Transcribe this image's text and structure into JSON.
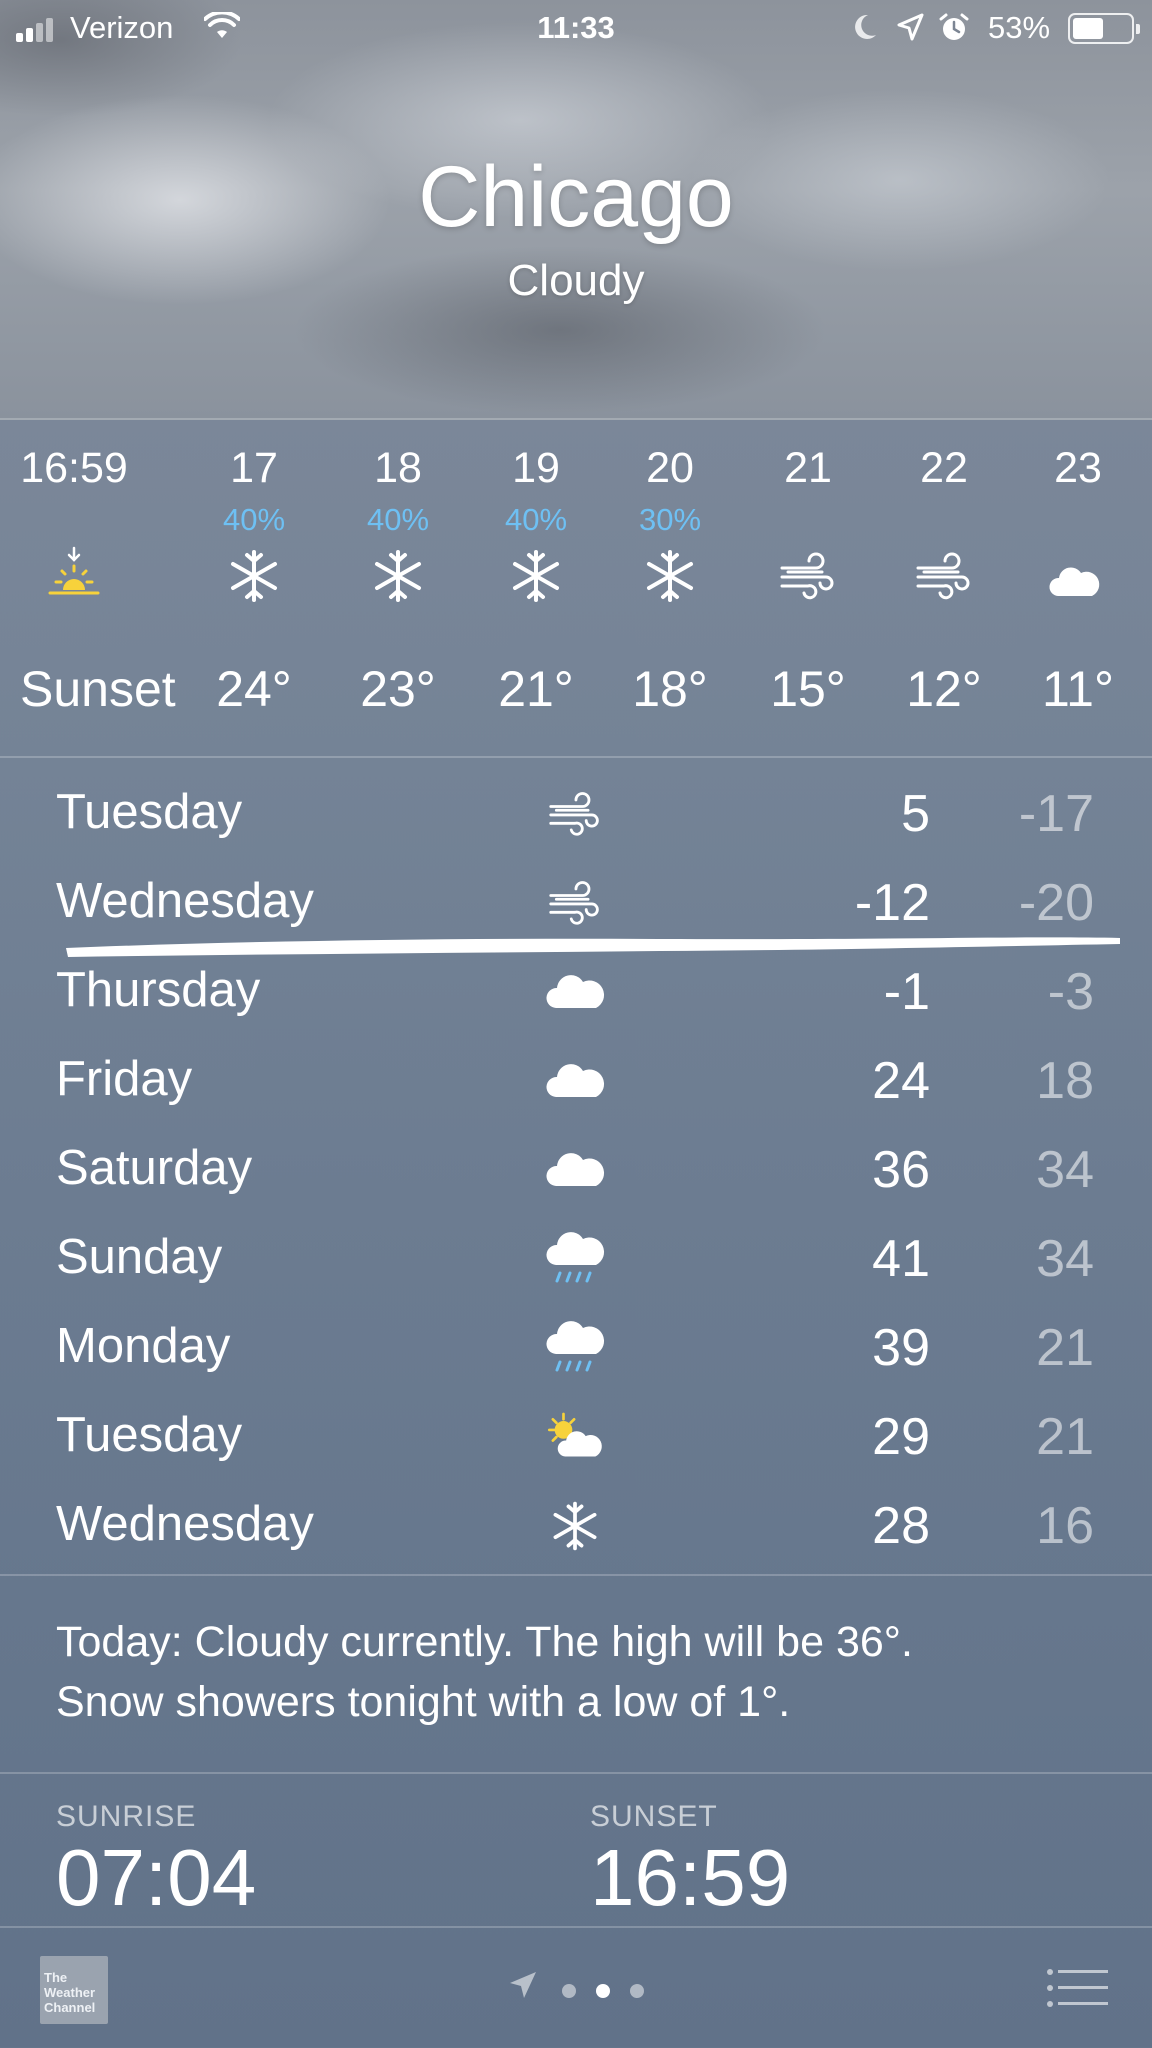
{
  "status_bar": {
    "carrier": "Verizon",
    "time": "11:33",
    "battery_percent": "53%",
    "battery_level": 0.53,
    "icons": [
      "signal-icon",
      "wifi-icon",
      "moon-icon",
      "location-arrow-icon",
      "alarm-icon",
      "battery-icon"
    ]
  },
  "header": {
    "city": "Chicago",
    "condition": "Cloudy"
  },
  "hourly": [
    {
      "time": "16:59",
      "pop": "",
      "icon": "sunset-icon",
      "temp": "Sunset"
    },
    {
      "time": "17",
      "pop": "40%",
      "icon": "snow-icon",
      "temp": "24°"
    },
    {
      "time": "18",
      "pop": "40%",
      "icon": "snow-icon",
      "temp": "23°"
    },
    {
      "time": "19",
      "pop": "40%",
      "icon": "snow-icon",
      "temp": "21°"
    },
    {
      "time": "20",
      "pop": "30%",
      "icon": "snow-icon",
      "temp": "18°"
    },
    {
      "time": "21",
      "pop": "",
      "icon": "wind-icon",
      "temp": "15°"
    },
    {
      "time": "22",
      "pop": "",
      "icon": "wind-icon",
      "temp": "12°"
    },
    {
      "time": "23",
      "pop": "",
      "icon": "partly-cloudy-night-icon",
      "temp": "11°"
    }
  ],
  "daily": [
    {
      "day": "Tuesday",
      "icon": "wind-icon",
      "high": "5",
      "low": "-17"
    },
    {
      "day": "Wednesday",
      "icon": "wind-icon",
      "high": "-12",
      "low": "-20"
    },
    {
      "day": "Thursday",
      "icon": "cloud-icon",
      "high": "-1",
      "low": "-3"
    },
    {
      "day": "Friday",
      "icon": "cloud-icon",
      "high": "24",
      "low": "18"
    },
    {
      "day": "Saturday",
      "icon": "cloud-icon",
      "high": "36",
      "low": "34"
    },
    {
      "day": "Sunday",
      "icon": "rain-icon",
      "high": "41",
      "low": "34"
    },
    {
      "day": "Monday",
      "icon": "rain-icon",
      "high": "39",
      "low": "21"
    },
    {
      "day": "Tuesday",
      "icon": "partly-sunny-icon",
      "high": "29",
      "low": "21"
    },
    {
      "day": "Wednesday",
      "icon": "snow-icon",
      "high": "28",
      "low": "16"
    }
  ],
  "summary": {
    "line1": "Today: Cloudy currently. The high will be 36°.",
    "line2": "Snow showers tonight with a low of 1°."
  },
  "details": {
    "sunrise_label": "SUNRISE",
    "sunrise_value": "07:04",
    "sunset_label": "SUNSET",
    "sunset_value": "16:59"
  },
  "footer": {
    "logo_text": [
      "The",
      "Weather",
      "Channel"
    ],
    "page_count": 3,
    "active_page": 2
  },
  "colors": {
    "precip_blue": "#6ec0f3",
    "sun_yellow": "#f7d23b"
  }
}
